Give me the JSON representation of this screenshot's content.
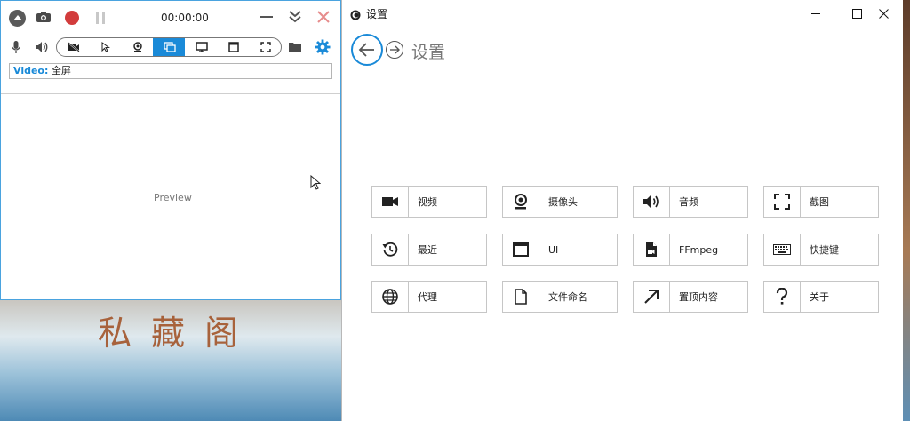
{
  "recorder": {
    "timer": "00:00:00",
    "source_label": "Video:",
    "source_value": "全屏",
    "preview_text": "Preview",
    "modes": [
      {
        "icon": "no-video-icon",
        "active": false
      },
      {
        "icon": "cursor-icon",
        "active": false
      },
      {
        "icon": "webcam-icon",
        "active": false
      },
      {
        "icon": "fullscreen-display-icon",
        "active": true
      },
      {
        "icon": "monitor-icon",
        "active": false
      },
      {
        "icon": "window-icon",
        "active": false
      },
      {
        "icon": "region-icon",
        "active": false
      }
    ],
    "colors": {
      "accent": "#1a8ad8",
      "record": "#d23c3c",
      "close": "#e68c8c"
    }
  },
  "desktop": {
    "wallpaper_text": "私藏阁"
  },
  "settings": {
    "window_title": "设置",
    "page_title": "设置",
    "tiles": [
      {
        "icon": "video-camera-icon",
        "label": "视频"
      },
      {
        "icon": "webcam-icon",
        "label": "摄像头"
      },
      {
        "icon": "speaker-icon",
        "label": "音频"
      },
      {
        "icon": "screenshot-icon",
        "label": "截图"
      },
      {
        "icon": "history-icon",
        "label": "最近"
      },
      {
        "icon": "window-ui-icon",
        "label": "UI"
      },
      {
        "icon": "file-video-icon",
        "label": "FFmpeg"
      },
      {
        "icon": "keyboard-icon",
        "label": "快捷键"
      },
      {
        "icon": "globe-icon",
        "label": "代理"
      },
      {
        "icon": "file-icon",
        "label": "文件命名"
      },
      {
        "icon": "arrow-up-right-icon",
        "label": "置顶内容"
      },
      {
        "icon": "question-icon",
        "label": "关于"
      }
    ]
  }
}
